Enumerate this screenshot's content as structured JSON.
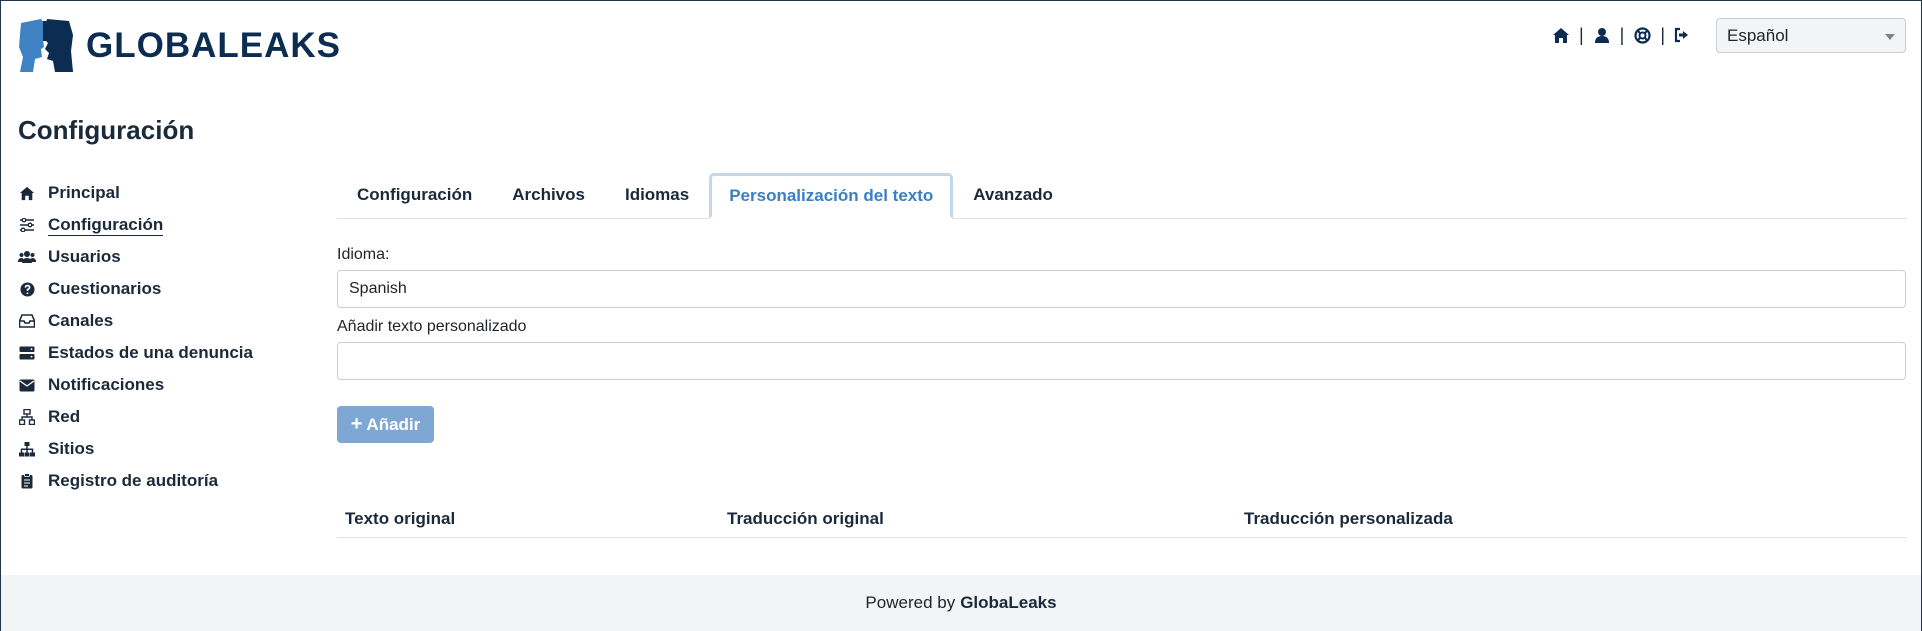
{
  "header": {
    "logo_text": "GLOBALEAKS",
    "nav_icons": [
      "home-icon",
      "user-icon",
      "support-icon",
      "logout-icon"
    ],
    "separator": "|",
    "language_selected": "Español"
  },
  "page": {
    "title": "Configuración"
  },
  "sidebar": {
    "items": [
      {
        "label": "Principal",
        "icon": "home-icon"
      },
      {
        "label": "Configuración",
        "icon": "sliders-icon",
        "active": true
      },
      {
        "label": "Usuarios",
        "icon": "users-icon"
      },
      {
        "label": "Cuestionarios",
        "icon": "question-circle-icon"
      },
      {
        "label": "Canales",
        "icon": "inbox-icon"
      },
      {
        "label": "Estados de una denuncia",
        "icon": "server-icon"
      },
      {
        "label": "Notificaciones",
        "icon": "envelope-icon"
      },
      {
        "label": "Red",
        "icon": "network-icon"
      },
      {
        "label": "Sitios",
        "icon": "sitemap-icon"
      },
      {
        "label": "Registro de auditoría",
        "icon": "clipboard-icon"
      }
    ]
  },
  "tabs": [
    {
      "label": "Configuración"
    },
    {
      "label": "Archivos"
    },
    {
      "label": "Idiomas"
    },
    {
      "label": "Personalización del texto",
      "active": true
    },
    {
      "label": "Avanzado"
    }
  ],
  "form": {
    "language_label": "Idioma:",
    "language_value": "Spanish",
    "custom_text_label": "Añadir texto personalizado",
    "custom_text_value": "",
    "add_button": "Añadir"
  },
  "table": {
    "headers": [
      "Texto original",
      "Traducción original",
      "Traducción personalizada"
    ]
  },
  "footer": {
    "prefix": "Powered by",
    "brand": "GlobaLeaks"
  },
  "colors": {
    "brand": "#0c2c52",
    "logo_blue": "#3f82c4",
    "accent": "#3a7fc4",
    "button": "#7ea7d4"
  }
}
